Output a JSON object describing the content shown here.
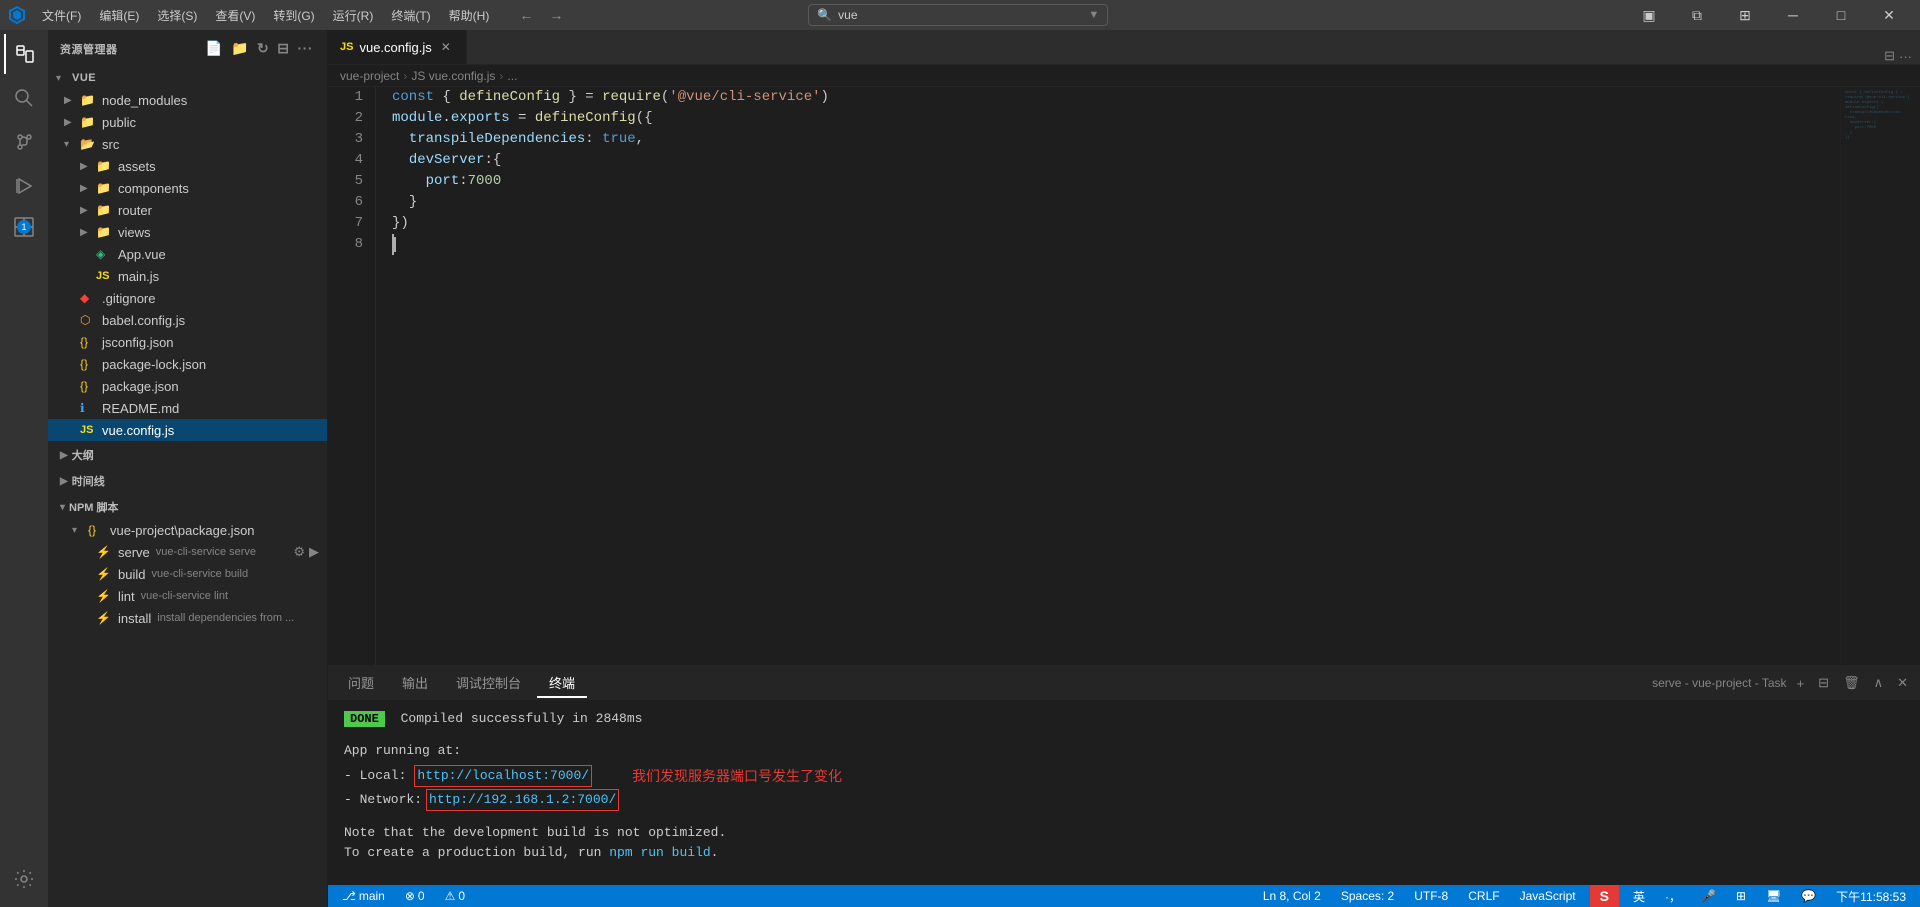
{
  "titlebar": {
    "logo": "⬡",
    "menus": [
      "文件(F)",
      "编辑(E)",
      "选择(S)",
      "查看(V)",
      "转到(G)",
      "运行(R)",
      "终端(T)",
      "帮助(H)"
    ],
    "search_placeholder": "vue",
    "nav_back": "←",
    "nav_forward": "→",
    "controls": [
      "🗖",
      "⧉",
      "⊞",
      "✕"
    ]
  },
  "sidebar": {
    "header": "资源管理器",
    "root": "VUE",
    "items": [
      {
        "id": "node_modules",
        "label": "node_modules",
        "type": "folder",
        "level": 1,
        "expanded": false
      },
      {
        "id": "public",
        "label": "public",
        "type": "folder",
        "level": 1,
        "expanded": false
      },
      {
        "id": "src",
        "label": "src",
        "type": "folder",
        "level": 1,
        "expanded": true
      },
      {
        "id": "assets",
        "label": "assets",
        "type": "folder",
        "level": 2,
        "expanded": false
      },
      {
        "id": "components",
        "label": "components",
        "type": "folder",
        "level": 2,
        "expanded": false
      },
      {
        "id": "router",
        "label": "router",
        "type": "folder",
        "level": 2,
        "expanded": false
      },
      {
        "id": "views",
        "label": "views",
        "type": "folder",
        "level": 2,
        "expanded": false
      },
      {
        "id": "app_vue",
        "label": "App.vue",
        "type": "vue",
        "level": 2
      },
      {
        "id": "main_js",
        "label": "main.js",
        "type": "js",
        "level": 2
      },
      {
        "id": "gitignore",
        "label": ".gitignore",
        "type": "git",
        "level": 1
      },
      {
        "id": "babel_config",
        "label": "babel.config.js",
        "type": "babel",
        "level": 1
      },
      {
        "id": "jsconfig",
        "label": "jsconfig.json",
        "type": "json",
        "level": 1
      },
      {
        "id": "package_lock",
        "label": "package-lock.json",
        "type": "json",
        "level": 1
      },
      {
        "id": "package_json",
        "label": "package.json",
        "type": "json",
        "level": 1
      },
      {
        "id": "readme",
        "label": "README.md",
        "type": "md",
        "level": 1
      },
      {
        "id": "vue_config",
        "label": "vue.config.js",
        "type": "js",
        "level": 1,
        "selected": true
      }
    ],
    "outline_label": "大纲",
    "timeline_label": "时间线",
    "npm_label": "NPM 脚本",
    "npm_file": "vue-project\\package.json",
    "npm_scripts": [
      {
        "name": "serve",
        "cmd": "vue-cli-service serve"
      },
      {
        "name": "build",
        "cmd": "vue-cli-service build"
      },
      {
        "name": "lint",
        "cmd": "vue-cli-service lint"
      },
      {
        "name": "install",
        "cmd": "install dependencies from ..."
      }
    ]
  },
  "editor": {
    "tab_label": "vue.config.js",
    "breadcrumb": [
      "vue-project",
      "JS vue.config.js",
      "..."
    ],
    "lines": [
      {
        "num": 1,
        "tokens": [
          {
            "t": "const",
            "c": "kw2"
          },
          {
            "t": " { ",
            "c": "punc"
          },
          {
            "t": "defineConfig",
            "c": "fn"
          },
          {
            "t": " } = ",
            "c": "punc"
          },
          {
            "t": "require",
            "c": "fn"
          },
          {
            "t": "(",
            "c": "punc"
          },
          {
            "t": "'@vue/cli-service'",
            "c": "str"
          },
          {
            "t": ")",
            "c": "punc"
          }
        ]
      },
      {
        "num": 2,
        "tokens": [
          {
            "t": "module",
            "c": "prop"
          },
          {
            "t": ".",
            "c": "punc"
          },
          {
            "t": "exports",
            "c": "prop"
          },
          {
            "t": " = ",
            "c": "op"
          },
          {
            "t": "defineConfig",
            "c": "fn"
          },
          {
            "t": "({",
            "c": "punc"
          }
        ]
      },
      {
        "num": 3,
        "tokens": [
          {
            "t": "  ",
            "c": ""
          },
          {
            "t": "transpileDependencies",
            "c": "prop"
          },
          {
            "t": ":",
            "c": "punc"
          },
          {
            "t": " true",
            "c": "kw2"
          },
          {
            "t": ",",
            "c": "punc"
          }
        ]
      },
      {
        "num": 4,
        "tokens": [
          {
            "t": "  ",
            "c": ""
          },
          {
            "t": "devServer",
            "c": "prop"
          },
          {
            "t": ":{",
            "c": "punc"
          }
        ]
      },
      {
        "num": 5,
        "tokens": [
          {
            "t": "    ",
            "c": ""
          },
          {
            "t": "port",
            "c": "prop"
          },
          {
            "t": ":",
            "c": "punc"
          },
          {
            "t": "7000",
            "c": "num"
          }
        ]
      },
      {
        "num": 6,
        "tokens": [
          {
            "t": "  ",
            "c": ""
          },
          {
            "t": "}",
            "c": "punc"
          }
        ]
      },
      {
        "num": 7,
        "tokens": [
          {
            "t": "})",
            "c": "punc"
          }
        ]
      },
      {
        "num": 8,
        "tokens": [
          {
            "t": "",
            "c": ""
          }
        ]
      }
    ]
  },
  "terminal": {
    "tabs": [
      "问题",
      "输出",
      "调试控制台",
      "终端"
    ],
    "active_tab": "终端",
    "task_label": "serve - vue-project - Task",
    "done_label": "DONE",
    "compiled_msg": "Compiled successfully in 2848ms",
    "app_running": "App running at:",
    "local_label": "- Local:",
    "local_url": "http://localhost:7000/",
    "network_label": "- Network:",
    "network_url": "http://192.168.1.2:7000/",
    "note1": "Note that the development build is not optimized.",
    "note2": "To create a production build, run ",
    "npm_build": "npm run build",
    "note2_end": ".",
    "annotation": "我们发现服务器端口号发生了变化"
  },
  "statusbar": {
    "git_branch": "⎇ main",
    "errors": "⊗ 0",
    "warnings": "⚠ 0",
    "language": "JavaScript",
    "encoding": "UTF-8",
    "line_ending": "CRLF",
    "position": "Ln 8, Col 2",
    "spaces": "Spaces: 2",
    "ime_items": [
      "英",
      "·，",
      "🎤",
      "⊞",
      "🖥",
      "💬"
    ],
    "time": "下午11:58:53"
  }
}
